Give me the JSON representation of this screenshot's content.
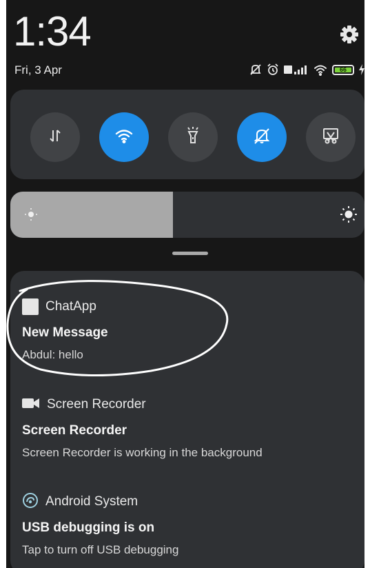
{
  "status_bar": {
    "time": "1:34",
    "date": "Fri, 3 Apr",
    "battery_level": "66"
  },
  "quick_settings": {
    "tiles": [
      {
        "name": "mobile-data",
        "icon": "data-arrows-icon",
        "active": false
      },
      {
        "name": "wifi",
        "icon": "wifi-icon",
        "active": true
      },
      {
        "name": "flashlight",
        "icon": "flashlight-icon",
        "active": false
      },
      {
        "name": "silent",
        "icon": "bell-off-icon",
        "active": true
      },
      {
        "name": "screenshot",
        "icon": "scissors-icon",
        "active": false
      }
    ],
    "brightness_fraction": 0.46
  },
  "notifications": [
    {
      "app": "ChatApp",
      "icon": "app-square-icon",
      "title": "New Message",
      "text": "Abdul: hello"
    },
    {
      "app": "Screen Recorder",
      "icon": "video-camera-icon",
      "title": "Screen Recorder",
      "text": "Screen Recorder is working in the background"
    },
    {
      "app": "Android System",
      "icon": "android-system-icon",
      "title": "USB debugging is on",
      "text": "Tap to turn off USB debugging"
    }
  ],
  "colors": {
    "accent": "#1e8de8",
    "panel": "#2f3134",
    "background": "#171717",
    "battery": "#7cd33a"
  }
}
